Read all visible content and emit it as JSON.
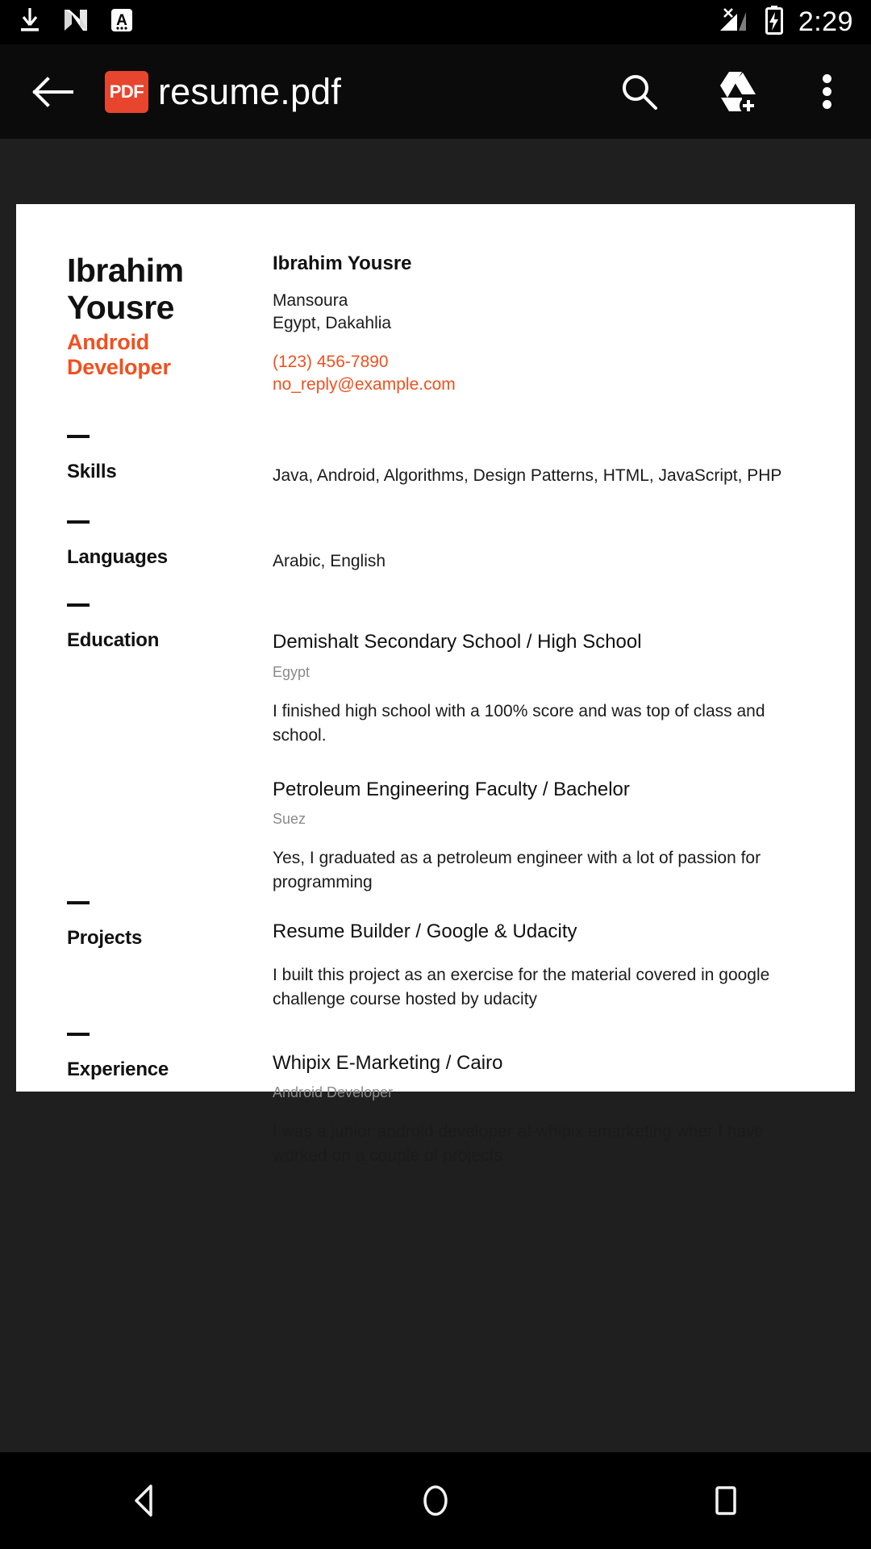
{
  "status_bar": {
    "icons": [
      "download-icon",
      "android-nougat-icon",
      "font-size-a-icon"
    ],
    "signal": "no-signal-icon",
    "battery": "battery-charging-icon",
    "time": "2:29"
  },
  "app_bar": {
    "back": "back-arrow-icon",
    "file_badge": "PDF",
    "title": "resume.pdf",
    "actions": [
      "search-icon",
      "add-to-drive-icon",
      "overflow-menu-icon"
    ]
  },
  "document": {
    "header": {
      "name": "Ibrahim Yousre",
      "role": "Android Developer"
    },
    "contact": {
      "name": "Ibrahim Yousre",
      "city": "Mansoura",
      "region": "Egypt, Dakahlia",
      "phone": "(123) 456-7890",
      "email": "no_reply@example.com"
    },
    "sections": {
      "skills": {
        "label": "Skills",
        "text": "Java, Android, Algorithms, Design Patterns, HTML, JavaScript, PHP"
      },
      "languages": {
        "label": "Languages",
        "text": "Arabic, English"
      },
      "education": {
        "label": "Education",
        "entries": [
          {
            "title": "Demishalt Secondary School / High School",
            "subtitle": "Egypt",
            "description": "I finished high school with a 100% score and was top of class and school."
          },
          {
            "title": "Petroleum Engineering Faculty / Bachelor",
            "subtitle": "Suez",
            "description": "Yes, I graduated as a petroleum engineer with a lot of passion for programming"
          }
        ]
      },
      "projects": {
        "label": "Projects",
        "entries": [
          {
            "title": "Resume Builder / Google & Udacity",
            "subtitle": "",
            "description": "I built this project as an exercise for the material covered in google challenge course hosted by udacity"
          }
        ]
      },
      "experience": {
        "label": "Experience",
        "entries": [
          {
            "title": "Whipix E-Marketing / Cairo",
            "subtitle": "Android Developer",
            "description": "I was a junior android developer at whipix emarketing wher I have worked on a couple of projects."
          }
        ]
      }
    }
  },
  "nav_bar": {
    "back": "nav-back-icon",
    "home": "nav-home-icon",
    "recents": "nav-recents-icon"
  },
  "colors": {
    "accent": "#f1501f",
    "pdf_badge": "#e8452f",
    "viewer_bg": "#1f1f1f",
    "bar_bg": "#000000"
  }
}
